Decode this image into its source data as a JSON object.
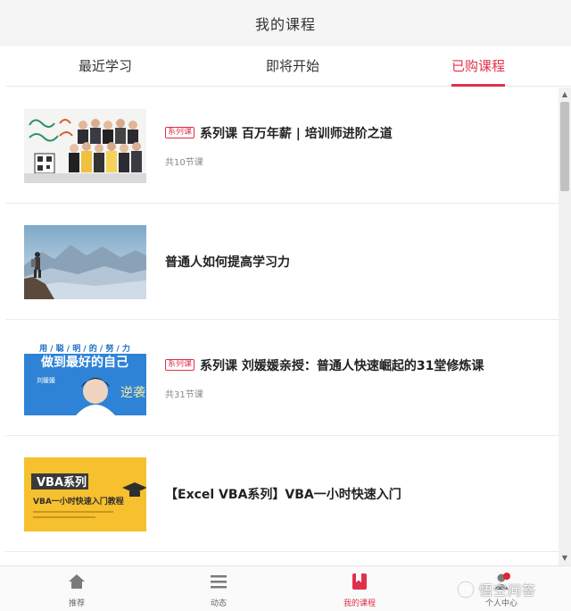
{
  "header": {
    "title": "我的课程"
  },
  "tabs": [
    {
      "label": "最近学习"
    },
    {
      "label": "即将开始"
    },
    {
      "label": "已购课程"
    }
  ],
  "active_tab": "已购课程",
  "accent_color": "#e0314b",
  "courses": [
    {
      "tag": "系列课",
      "title": "系列课 百万年薪 | 培训师进阶之道",
      "count": "共10节课"
    },
    {
      "tag": "",
      "title": "普通人如何提高学习力",
      "count": ""
    },
    {
      "tag": "系列课",
      "title": "系列课 刘媛媛亲授：普通人快速崛起的31堂修炼课",
      "count": "共31节课",
      "thumb_text_top": "用 / 聪 / 明 / 的 / 努 / 力",
      "thumb_text_main": "做到最好的自己",
      "thumb_name": "刘媛媛",
      "thumb_sub": "逆袭"
    },
    {
      "tag": "",
      "title": "【Excel VBA系列】VBA一小时快速入门",
      "count": "",
      "thumb_badge": "VBA系列",
      "thumb_text": "VBA一小时快速入门教程"
    }
  ],
  "bottom_nav": [
    {
      "label": "推荐",
      "icon": "home-icon"
    },
    {
      "label": "动态",
      "icon": "list-icon"
    },
    {
      "label": "我的课程",
      "icon": "bookmark-book-icon"
    },
    {
      "label": "个人中心",
      "icon": "person-icon"
    }
  ],
  "watermark": {
    "text": "悟空问答"
  }
}
